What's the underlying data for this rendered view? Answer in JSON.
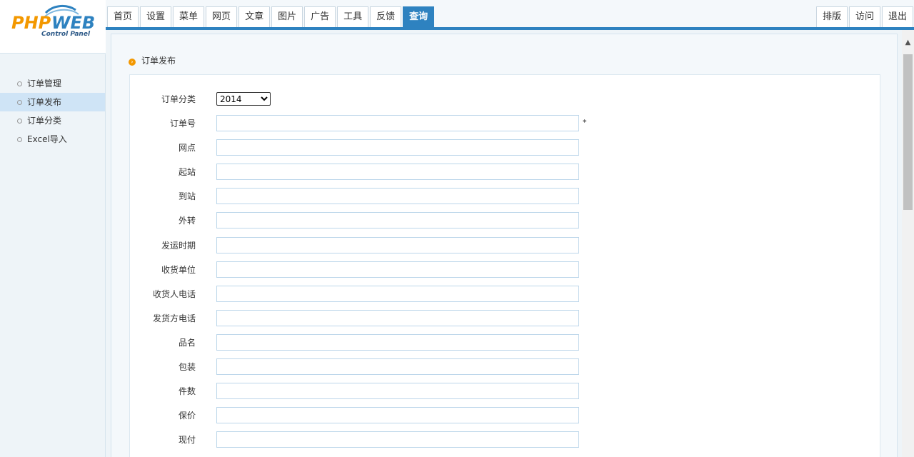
{
  "logo": {
    "brand": "PHPWEB",
    "subtitle": "Control Panel"
  },
  "nav": {
    "tabs": [
      "首页",
      "设置",
      "菜单",
      "网页",
      "文章",
      "图片",
      "广告",
      "工具",
      "反馈",
      "查询"
    ],
    "active_tab": "查询",
    "right": [
      "排版",
      "访问",
      "退出"
    ]
  },
  "sidebar": {
    "items": [
      "订单管理",
      "订单发布",
      "订单分类",
      "Excel导入"
    ],
    "active_item": "订单发布"
  },
  "main": {
    "section_title": "订单发布",
    "form": {
      "category_label": "订单分类",
      "category_value": "2014",
      "fields": [
        {
          "label": "订单号",
          "value": "",
          "required_mark": "*"
        },
        {
          "label": "网点",
          "value": ""
        },
        {
          "label": "起站",
          "value": ""
        },
        {
          "label": "到站",
          "value": ""
        },
        {
          "label": "外转",
          "value": ""
        },
        {
          "label": "发运时期",
          "value": ""
        },
        {
          "label": "收货单位",
          "value": ""
        },
        {
          "label": "收货人电话",
          "value": ""
        },
        {
          "label": "发货方电话",
          "value": ""
        },
        {
          "label": "品名",
          "value": ""
        },
        {
          "label": "包装",
          "value": ""
        },
        {
          "label": "件数",
          "value": ""
        },
        {
          "label": "保价",
          "value": ""
        },
        {
          "label": "现付",
          "value": ""
        }
      ]
    }
  },
  "colors": {
    "accent": "#2e82c0",
    "sidebar_active": "#cfe4f6",
    "bullet": "#f39800"
  }
}
